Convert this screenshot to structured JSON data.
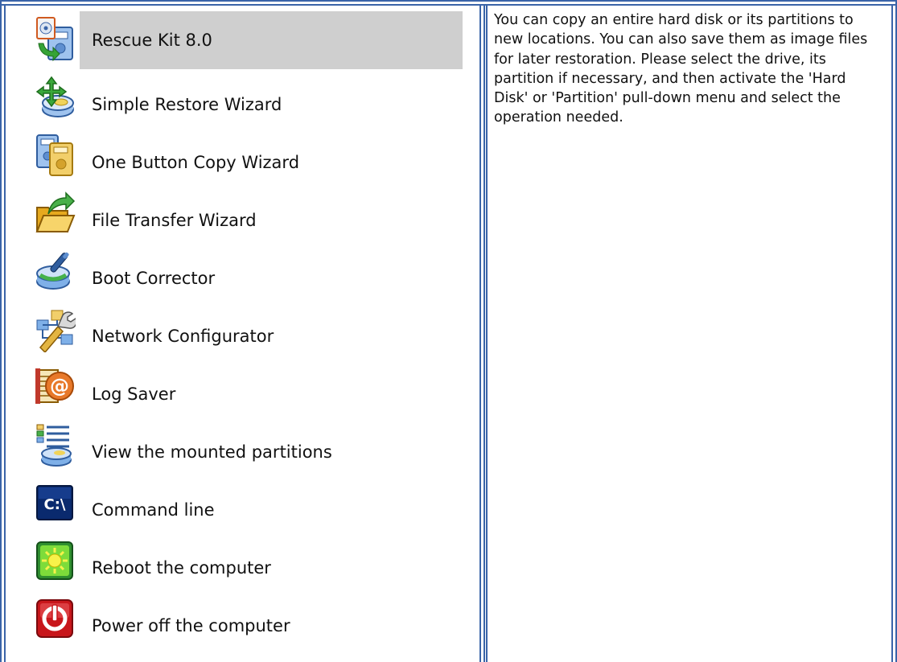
{
  "menu": {
    "items": [
      {
        "label": "Rescue Kit 8.0",
        "icon": "rescue-kit-icon",
        "selected": true
      },
      {
        "label": "Simple Restore Wizard",
        "icon": "restore-wizard-icon"
      },
      {
        "label": "One Button Copy Wizard",
        "icon": "copy-wizard-icon"
      },
      {
        "label": "File Transfer Wizard",
        "icon": "file-transfer-icon"
      },
      {
        "label": "Boot Corrector",
        "icon": "boot-corrector-icon"
      },
      {
        "label": "Network Configurator",
        "icon": "network-configurator-icon"
      },
      {
        "label": "Log Saver",
        "icon": "log-saver-icon"
      },
      {
        "label": "View the mounted partitions",
        "icon": "mounted-partitions-icon"
      },
      {
        "label": "Command line",
        "icon": "command-line-icon"
      },
      {
        "label": "Reboot the computer",
        "icon": "reboot-icon"
      },
      {
        "label": "Power off the computer",
        "icon": "power-off-icon"
      }
    ]
  },
  "description": {
    "text": "You can copy an entire hard disk or its partitions to new locations. You can also save them as image files for later restoration. Please select the drive, its partition if necessary, and then activate the 'Hard Disk' or 'Partition' pull-down menu and select the operation needed."
  },
  "colors": {
    "border": "#3a64a8",
    "selection": "#cfcfcf"
  }
}
